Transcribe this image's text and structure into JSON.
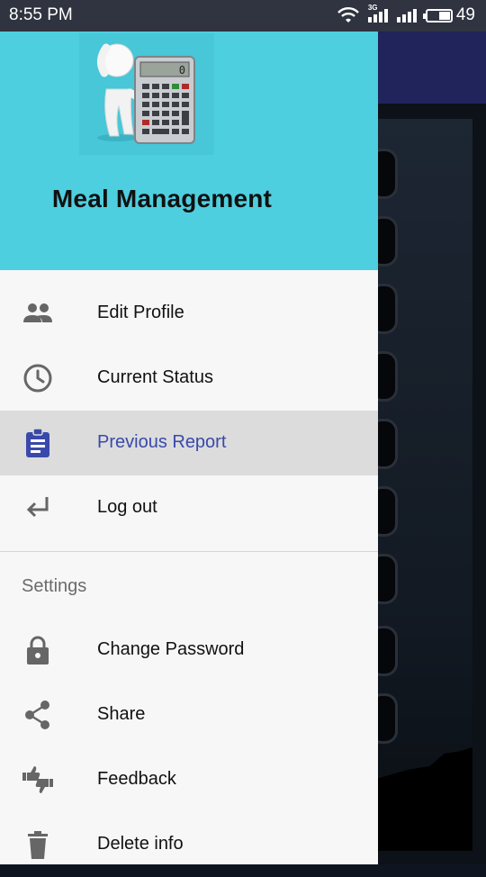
{
  "status_bar": {
    "time": "8:55 PM",
    "network_label": "3G",
    "battery_level": "49",
    "battery_fraction": 0.49
  },
  "drawer": {
    "app_title": "Meal Management",
    "logo_icon": "calculator-mascot-icon",
    "menu": [
      {
        "label": "Edit Profile",
        "icon": "people-icon"
      },
      {
        "label": "Current Status",
        "icon": "clock-icon"
      },
      {
        "label": "Previous Report",
        "icon": "clipboard-icon",
        "active": true
      },
      {
        "label": "Log out",
        "icon": "return-arrow-icon"
      }
    ],
    "settings_title": "Settings",
    "settings_menu": [
      {
        "label": "Change Password",
        "icon": "lock-icon"
      },
      {
        "label": "Share",
        "icon": "share-icon"
      },
      {
        "label": "Feedback",
        "icon": "thumbs-up-down-icon"
      },
      {
        "label": "Delete info",
        "icon": "trash-icon"
      }
    ]
  },
  "colors": {
    "header": "#4ecfe0",
    "active_accent": "#3949ab",
    "icon_gray": "#666666"
  }
}
